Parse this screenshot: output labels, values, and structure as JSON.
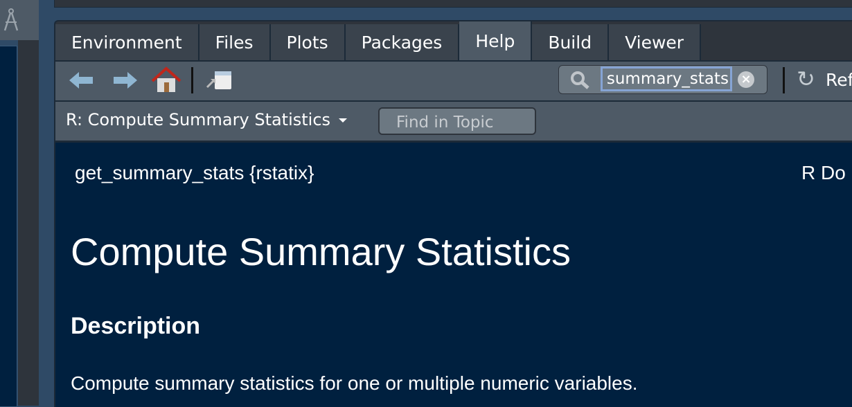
{
  "tabs": [
    {
      "label": "Environment",
      "active": false
    },
    {
      "label": "Files",
      "active": false
    },
    {
      "label": "Plots",
      "active": false
    },
    {
      "label": "Packages",
      "active": false
    },
    {
      "label": "Help",
      "active": true
    },
    {
      "label": "Build",
      "active": false
    },
    {
      "label": "Viewer",
      "active": false
    }
  ],
  "toolbar": {
    "search_value": "summary_stats",
    "refresh_label": "Ref",
    "icons": [
      "back-arrow",
      "forward-arrow",
      "home",
      "popout",
      "search",
      "clear",
      "refresh"
    ]
  },
  "topicbar": {
    "topic": "R: Compute Summary Statistics",
    "find_placeholder": "Find in Topic"
  },
  "content": {
    "usage": "get_summary_stats {rstatix}",
    "rdoc": "R Do",
    "title": "Compute Summary Statistics",
    "section": "Description",
    "description": "Compute summary statistics for one or multiple numeric variables."
  },
  "colors": {
    "content_bg": "#00203f",
    "toolbar_bg": "#4e5a66",
    "accent_focus": "#86a4d4"
  }
}
